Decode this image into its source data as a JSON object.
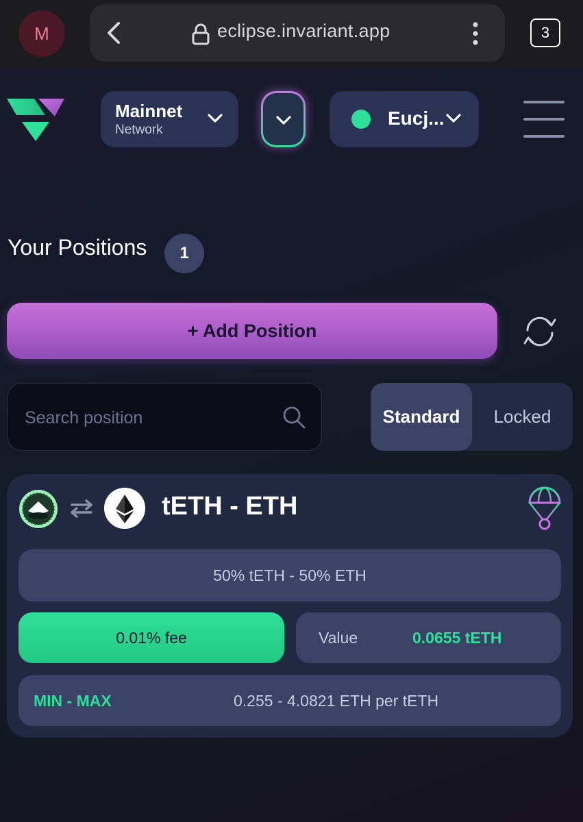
{
  "browser": {
    "profile_initial": "M",
    "url": "eclipse.invariant.app",
    "tab_count": "3"
  },
  "header": {
    "network": {
      "name": "Mainnet",
      "label": "Network"
    },
    "wallet": {
      "address_short": "Eucj...",
      "status_color": "#2ee09a"
    }
  },
  "positions": {
    "title": "Your Positions",
    "count": "1",
    "add_button": "+ Add Position",
    "search_placeholder": "Search position",
    "filter_tabs": [
      {
        "label": "Standard",
        "active": true
      },
      {
        "label": "Locked",
        "active": false
      }
    ]
  },
  "position_card": {
    "pair": "tETH - ETH",
    "token_a_icon": "teth-token-icon",
    "token_b_icon": "eth-token-icon",
    "ratio": "50% tETH - 50% ETH",
    "fee": "0.01% fee",
    "value_label": "Value",
    "value_amount": "0.0655 tETH",
    "range_label": "MIN - MAX",
    "range_value": "0.255 - 4.0821 ETH per tETH"
  },
  "colors": {
    "accent_green": "#2ee09a",
    "accent_purple": "#b564d4",
    "card_bg": "#202842"
  }
}
